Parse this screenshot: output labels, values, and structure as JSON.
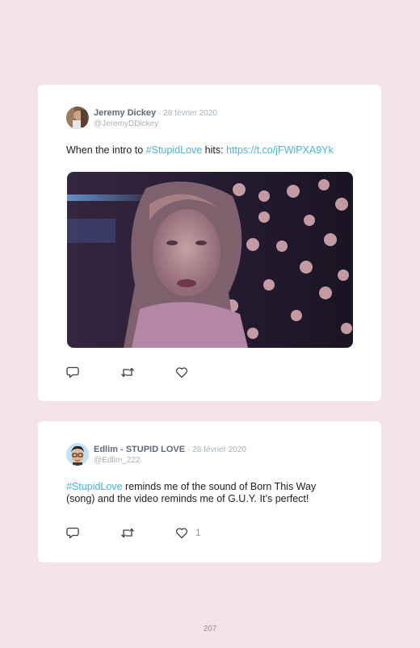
{
  "tweets": [
    {
      "author_name": "Jeremy Dickey",
      "date": "· 28 février 2020",
      "handle": "@JeremyDDickey",
      "text_before": "When the intro to ",
      "hashtag": "#StupidLove",
      "text_middle": " hits: ",
      "link": "https://t.co/jFWiPXA9Yk",
      "has_media": true,
      "media_icon": "gif-video-still",
      "action_icons": [
        "reply-icon",
        "retweet-icon",
        "like-icon"
      ]
    },
    {
      "author_name": "Edlim - STUPID LOVE",
      "date": "· 28 février 2020",
      "handle": "@Edlim_222",
      "hashtag": "#StupidLove",
      "text_line1_rest": " reminds me of the sound of Born This Way",
      "text_line2": "(song) and the video reminds me of G.U.Y. It’s perfect!",
      "likes": "1",
      "action_icons": [
        "reply-icon",
        "retweet-icon",
        "like-icon"
      ]
    }
  ],
  "page_number": "207",
  "colors": {
    "background": "#f4e4e8",
    "card": "#ffffff",
    "link": "#4ab3e0",
    "name": "#5d6a7a",
    "meta": "#a8b2bc"
  }
}
